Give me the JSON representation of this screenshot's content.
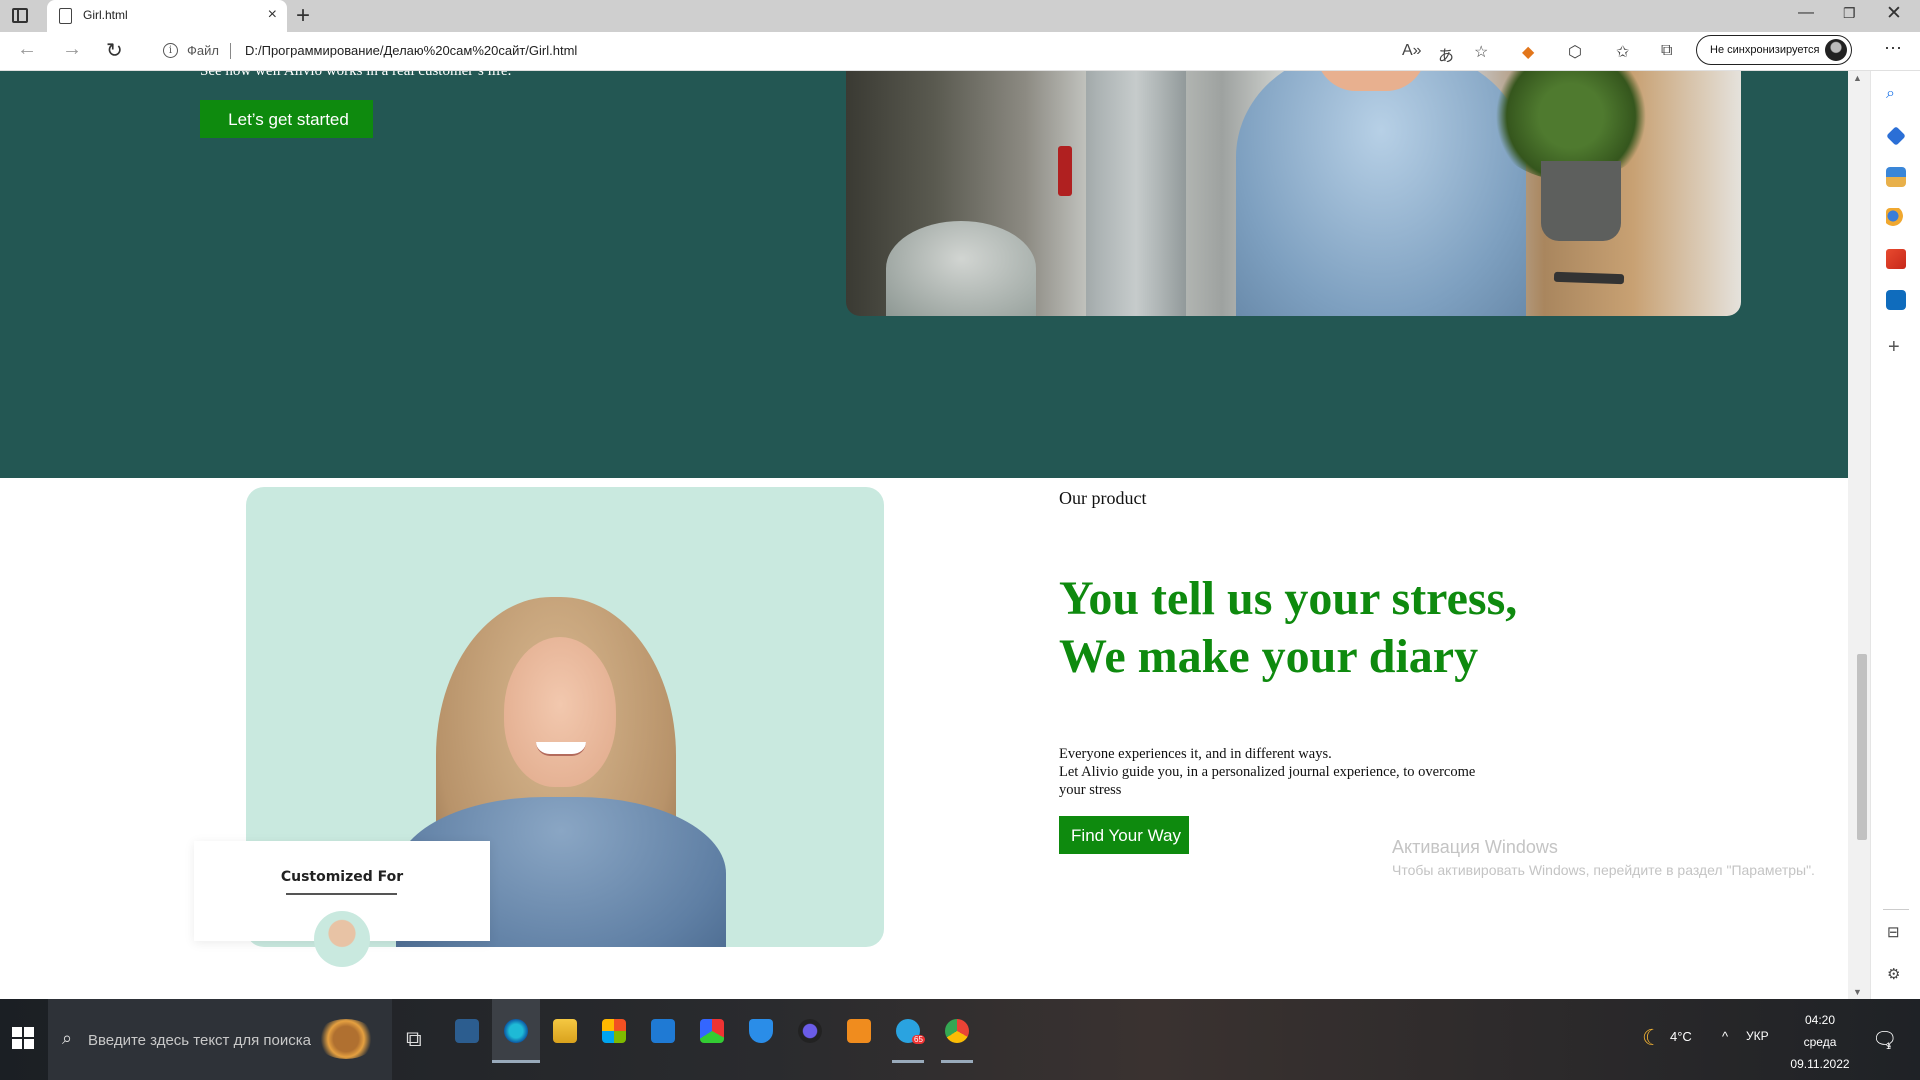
{
  "browser": {
    "tab_title": "Girl.html",
    "new_tab": "+",
    "file_label": "Файл",
    "url": "D:/Программирование/Делаю%20сам%20сайт/Girl.html",
    "sync_label": "Не синхронизируется",
    "window_controls": {
      "minimize": "—",
      "restore": "❐",
      "close": "✕"
    },
    "icons": [
      "read-aloud-icon",
      "translate-icon",
      "favorite-add-icon",
      "metamask-icon",
      "extensions-icon",
      "favorites-icon",
      "collections-icon",
      "more-icon"
    ]
  },
  "hero": {
    "subtitle": "See how well Alivio works in a real customer’s life.",
    "cta": "Let’s get started"
  },
  "product": {
    "eyebrow": "Our product",
    "headline_line1": "You tell us your stress,",
    "headline_line2": "We make your diary",
    "body_line1": "Everyone experiences it, and in different ways.",
    "body_line2": "Let Alivio guide you, in a personalized journal experience, to overcome your stress",
    "cta": "Find Your Way",
    "card_title": "Customized For"
  },
  "watermark": {
    "title": "Активация Windows",
    "subtitle": "Чтобы активировать Windows, перейдите в раздел \"Параметры\"."
  },
  "taskbar": {
    "search_placeholder": "Введите здесь текст для поиска",
    "weather": "4°C",
    "language": "УКР",
    "time": "04:20",
    "weekday": "среда",
    "date": "09.11.2022",
    "notification_count": "1",
    "telegram_badge": "65"
  },
  "colors": {
    "hero_bg": "#235753",
    "accent_green": "#0e8a0e",
    "card_mint": "#c9e9df"
  }
}
